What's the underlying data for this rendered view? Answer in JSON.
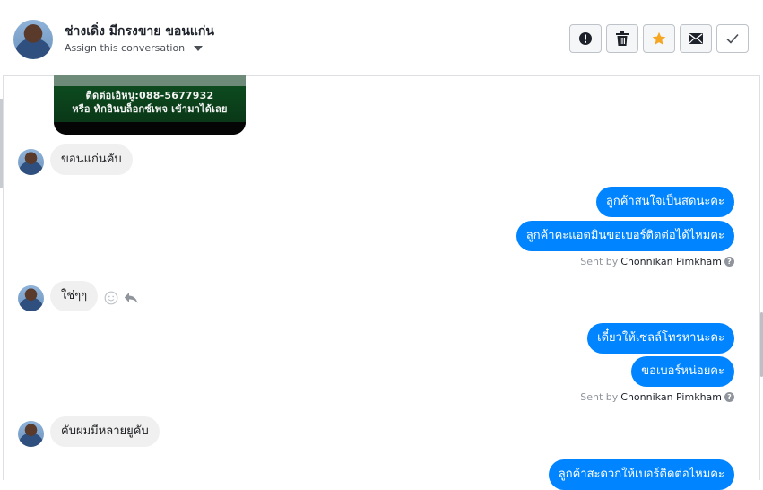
{
  "header": {
    "contact_name": "ช่างเดิ่ง มีกรงขาย ขอนแก่น",
    "assign_label": "Assign this conversation",
    "actions": [
      {
        "name": "mark-spam-button",
        "icon": "exclamation-circle-icon"
      },
      {
        "name": "delete-button",
        "icon": "trash-icon"
      },
      {
        "name": "star-button",
        "icon": "star-icon",
        "color": "#f5a623"
      },
      {
        "name": "mark-unread-button",
        "icon": "envelope-icon"
      },
      {
        "name": "mark-done-button",
        "icon": "checkmark-icon"
      }
    ]
  },
  "attachment": {
    "line1": "ติดต่อเอิหนู:088-5677932",
    "line2": "หรือ ทักอินบล็อกซ์เพจ เข้ามาได้เลย"
  },
  "messages": {
    "in1": "ขอนแก่นคับ",
    "out1": "ลูกค้าสนใจเป็นสดนะคะ",
    "out2": "ลูกค้าคะแอดมินขอเบอร์ติดต่อได้ไหมคะ",
    "sent1_prefix": "Sent by",
    "sent1_name": "Chonnikan Pimkham",
    "in2": "ใช่ๆๆ",
    "out3": "เดี๋ยวให้เซลล์โทรหานะคะ",
    "out4": "ขอเบอร์หน่อยคะ",
    "sent2_prefix": "Sent by",
    "sent2_name": "Chonnikan Pimkham",
    "in3": "คับผมมีหลายยูคับ",
    "out5": "ลูกค้าสะดวกให้เบอร์ติดต่อไหมคะ"
  },
  "colors": {
    "outgoing_bubble": "#0084ff",
    "incoming_bubble": "#f1f0f0",
    "star": "#f5a623"
  }
}
